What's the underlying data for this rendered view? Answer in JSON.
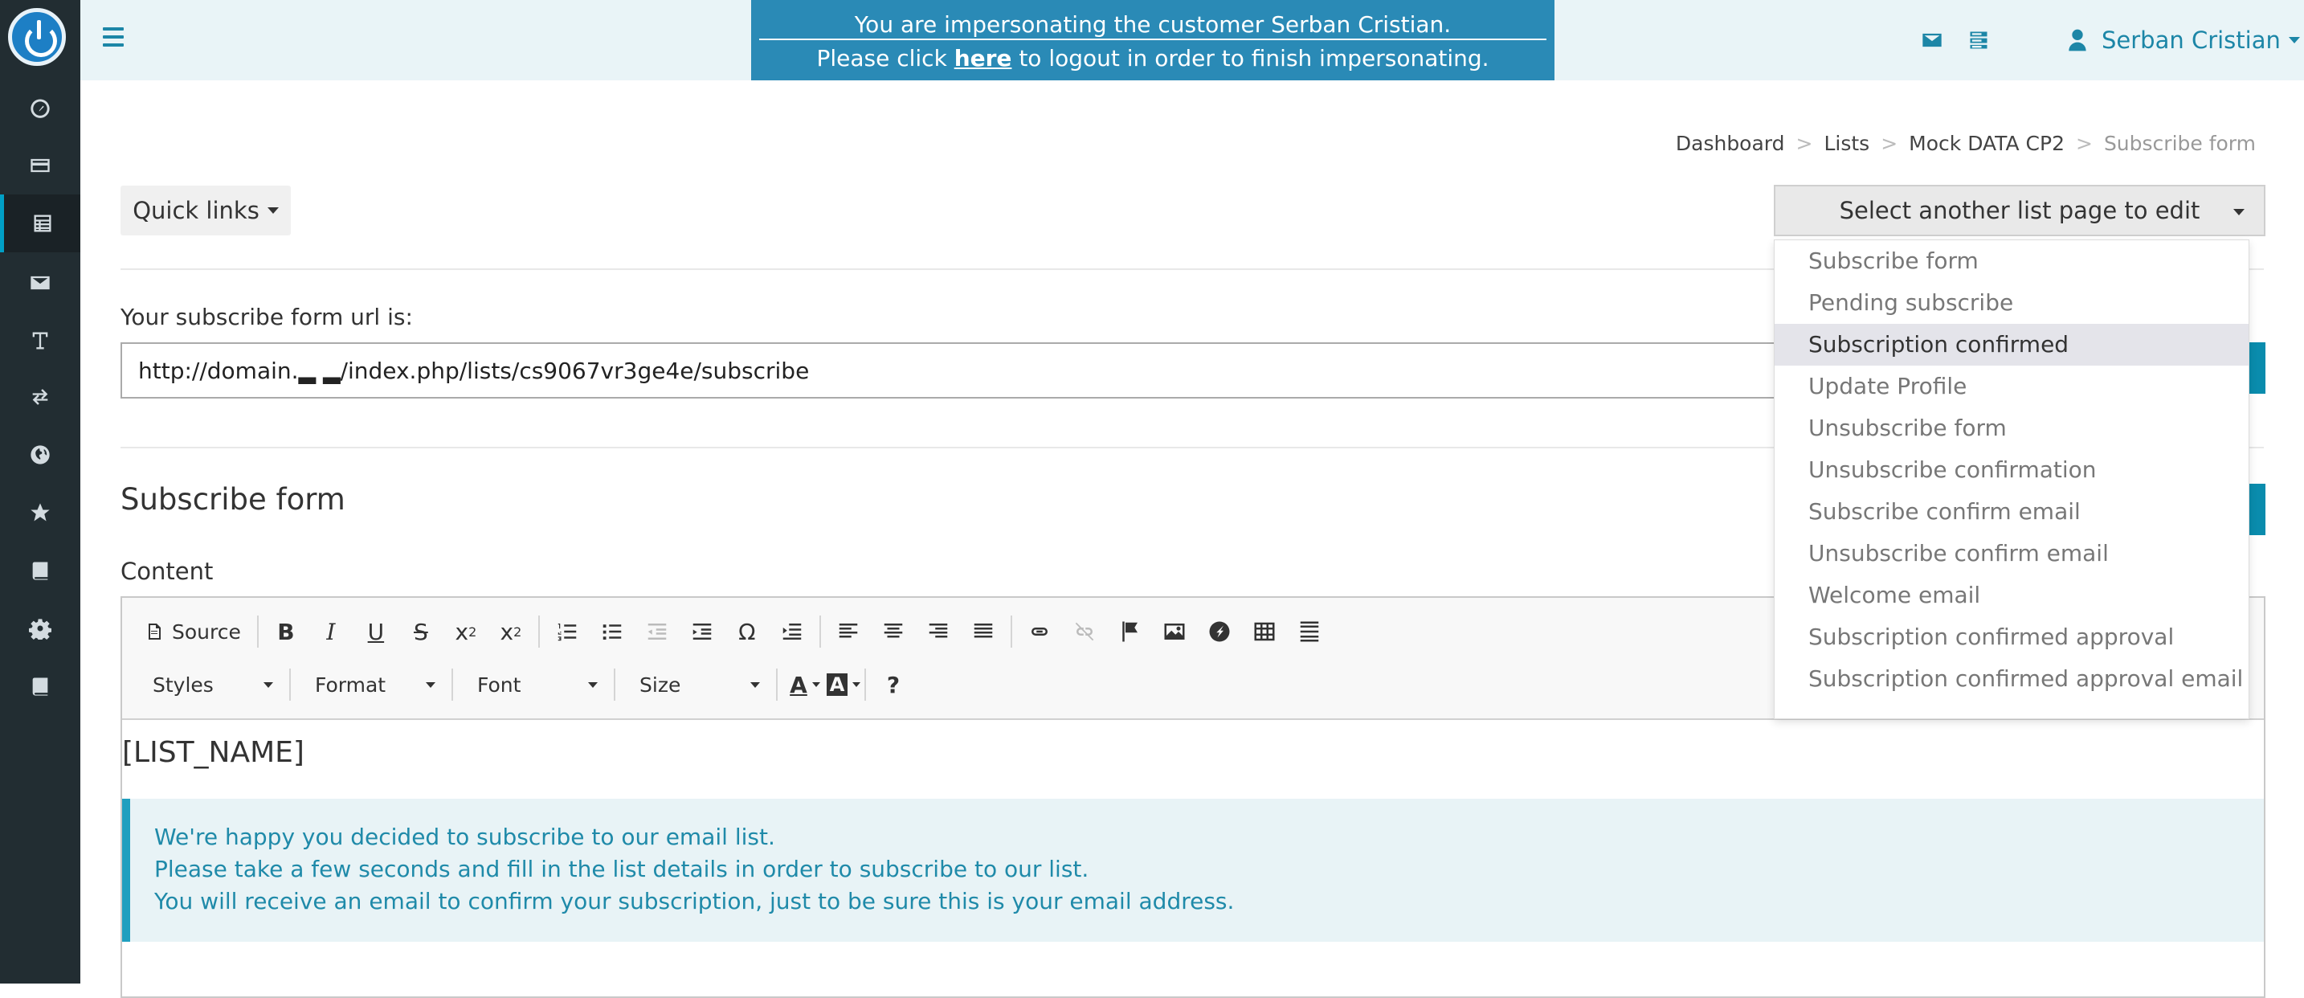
{
  "colors": {
    "sidebar_bg": "#222d32",
    "header_bg": "#e9f4f7",
    "accent": "#1c86a7",
    "impersonation_bg": "#2a8ab6",
    "callout_bg": "#e8f3f6",
    "callout_text": "#1f8aa9"
  },
  "sidebar": {
    "items": [
      {
        "icon": "dashboard-icon"
      },
      {
        "icon": "credit-card-icon"
      },
      {
        "icon": "list-icon",
        "active": true
      },
      {
        "icon": "envelope-icon"
      },
      {
        "icon": "text-icon"
      },
      {
        "icon": "exchange-icon"
      },
      {
        "icon": "globe-icon"
      },
      {
        "icon": "star-icon"
      },
      {
        "icon": "book-icon"
      },
      {
        "icon": "gear-icon"
      },
      {
        "icon": "book-icon"
      }
    ]
  },
  "impersonation": {
    "line1": "You are impersonating the customer Serban Cristian.",
    "line2_prefix": "Please click",
    "link": "here",
    "line2_suffix": "to logout in order to finish impersonating."
  },
  "header": {
    "user_name": "Serban Cristian"
  },
  "breadcrumb": [
    "Dashboard",
    "Lists",
    "Mock DATA CP2",
    "Subscribe form"
  ],
  "quick_links": "Quick links",
  "page_selector": {
    "label": "Select another list page to edit",
    "options": [
      "Subscribe form",
      "Pending subscribe",
      "Subscription confirmed",
      "Update Profile",
      "Unsubscribe form",
      "Unsubscribe confirmation",
      "Subscribe confirm email",
      "Unsubscribe confirm email",
      "Welcome email",
      "Subscription confirmed approval",
      "Subscription confirmed approval email"
    ],
    "highlighted": "Subscription confirmed"
  },
  "url_section": {
    "label": "Your subscribe form url is:",
    "value": "http://domain.▂          ▂/index.php/lists/cs9067vr3ge4e/subscribe"
  },
  "section_title": "Subscribe form",
  "content_label": "Content",
  "editor": {
    "source": "Source",
    "styles": "Styles",
    "format": "Format",
    "font": "Font",
    "size": "Size",
    "list_name": "[LIST_NAME]",
    "callout": [
      "We're happy you decided to subscribe to our email list.",
      "Please take a few seconds and fill in the list details in order to subscribe to our list.",
      "You will receive an email to confirm your subscription, just to be sure this is your email address."
    ]
  }
}
